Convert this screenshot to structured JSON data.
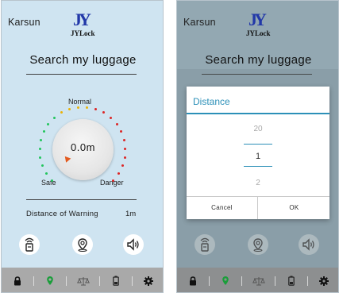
{
  "app": {
    "brand_name": "Karsun",
    "logo_mark": "JY",
    "logo_text": "JYLock",
    "page_title": "Search my luggage"
  },
  "gauge": {
    "top_label": "Normal",
    "left_label": "Safe",
    "right_label": "Danger",
    "value": "0.0m",
    "colors": {
      "safe": "#22c55e",
      "normal": "#eab308",
      "danger": "#dc2626"
    }
  },
  "warning": {
    "label": "Distance of Warning",
    "value": "1m"
  },
  "actions": [
    {
      "icon": "locator-device-icon"
    },
    {
      "icon": "map-pin-icon"
    },
    {
      "icon": "speaker-icon"
    }
  ],
  "tabbar": {
    "tabs": [
      {
        "icon": "lock-icon",
        "color": "#111111"
      },
      {
        "icon": "location-pin-icon",
        "color": "#1a9e3a"
      },
      {
        "icon": "scale-icon",
        "color": "#555555"
      },
      {
        "icon": "battery-icon",
        "color": "#222222"
      },
      {
        "icon": "gear-icon",
        "color": "#111111"
      }
    ]
  },
  "dialog": {
    "title": "Distance",
    "options": [
      "20",
      "1",
      "2"
    ],
    "selected": "1",
    "cancel_label": "Cancel",
    "ok_label": "OK"
  }
}
